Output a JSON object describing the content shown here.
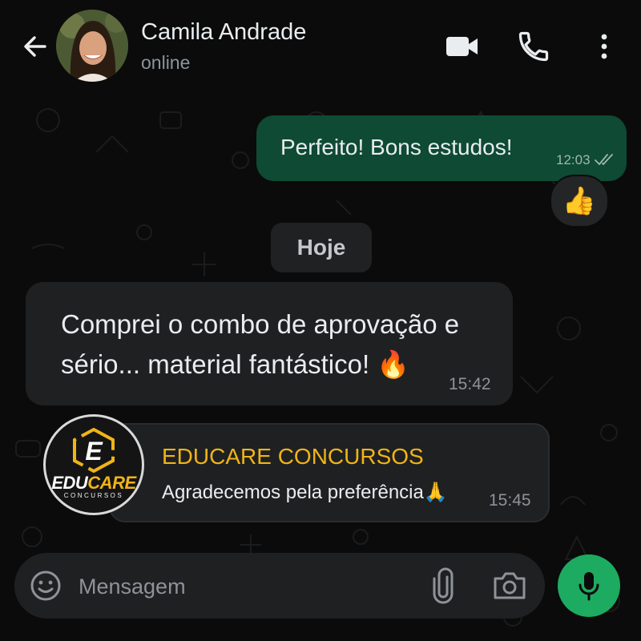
{
  "header": {
    "contact_name": "Camila Andrade",
    "status": "online",
    "icons": [
      "back-arrow-icon",
      "avatar",
      "video-call-icon",
      "phone-icon",
      "menu-dots-icon"
    ]
  },
  "messages": {
    "outgoing": {
      "text": "Perfeito! Bons estudos!",
      "time": "12:03",
      "reaction": "👍"
    },
    "date_chip": "Hoje",
    "incoming": {
      "text": "Comprei o combo de aprovação e sério... material fantástico! 🔥",
      "time": "15:42"
    },
    "reply": {
      "sender": "EDUCARE CONCURSOS",
      "text": "Agradecemos pela preferência🙏",
      "time": "15:45",
      "logo": {
        "word_part1": "EDU",
        "word_part2": "CARE",
        "subtitle": "CONCURSOS",
        "emblem_letter": "E"
      }
    }
  },
  "composer": {
    "placeholder": "Mensagem"
  },
  "colors": {
    "background": "#0b0b0b",
    "outgoing_bubble": "#0e4a34",
    "incoming_bubble": "#1f2022",
    "accent_yellow": "#f0b418",
    "mic_green": "#1dab61"
  }
}
